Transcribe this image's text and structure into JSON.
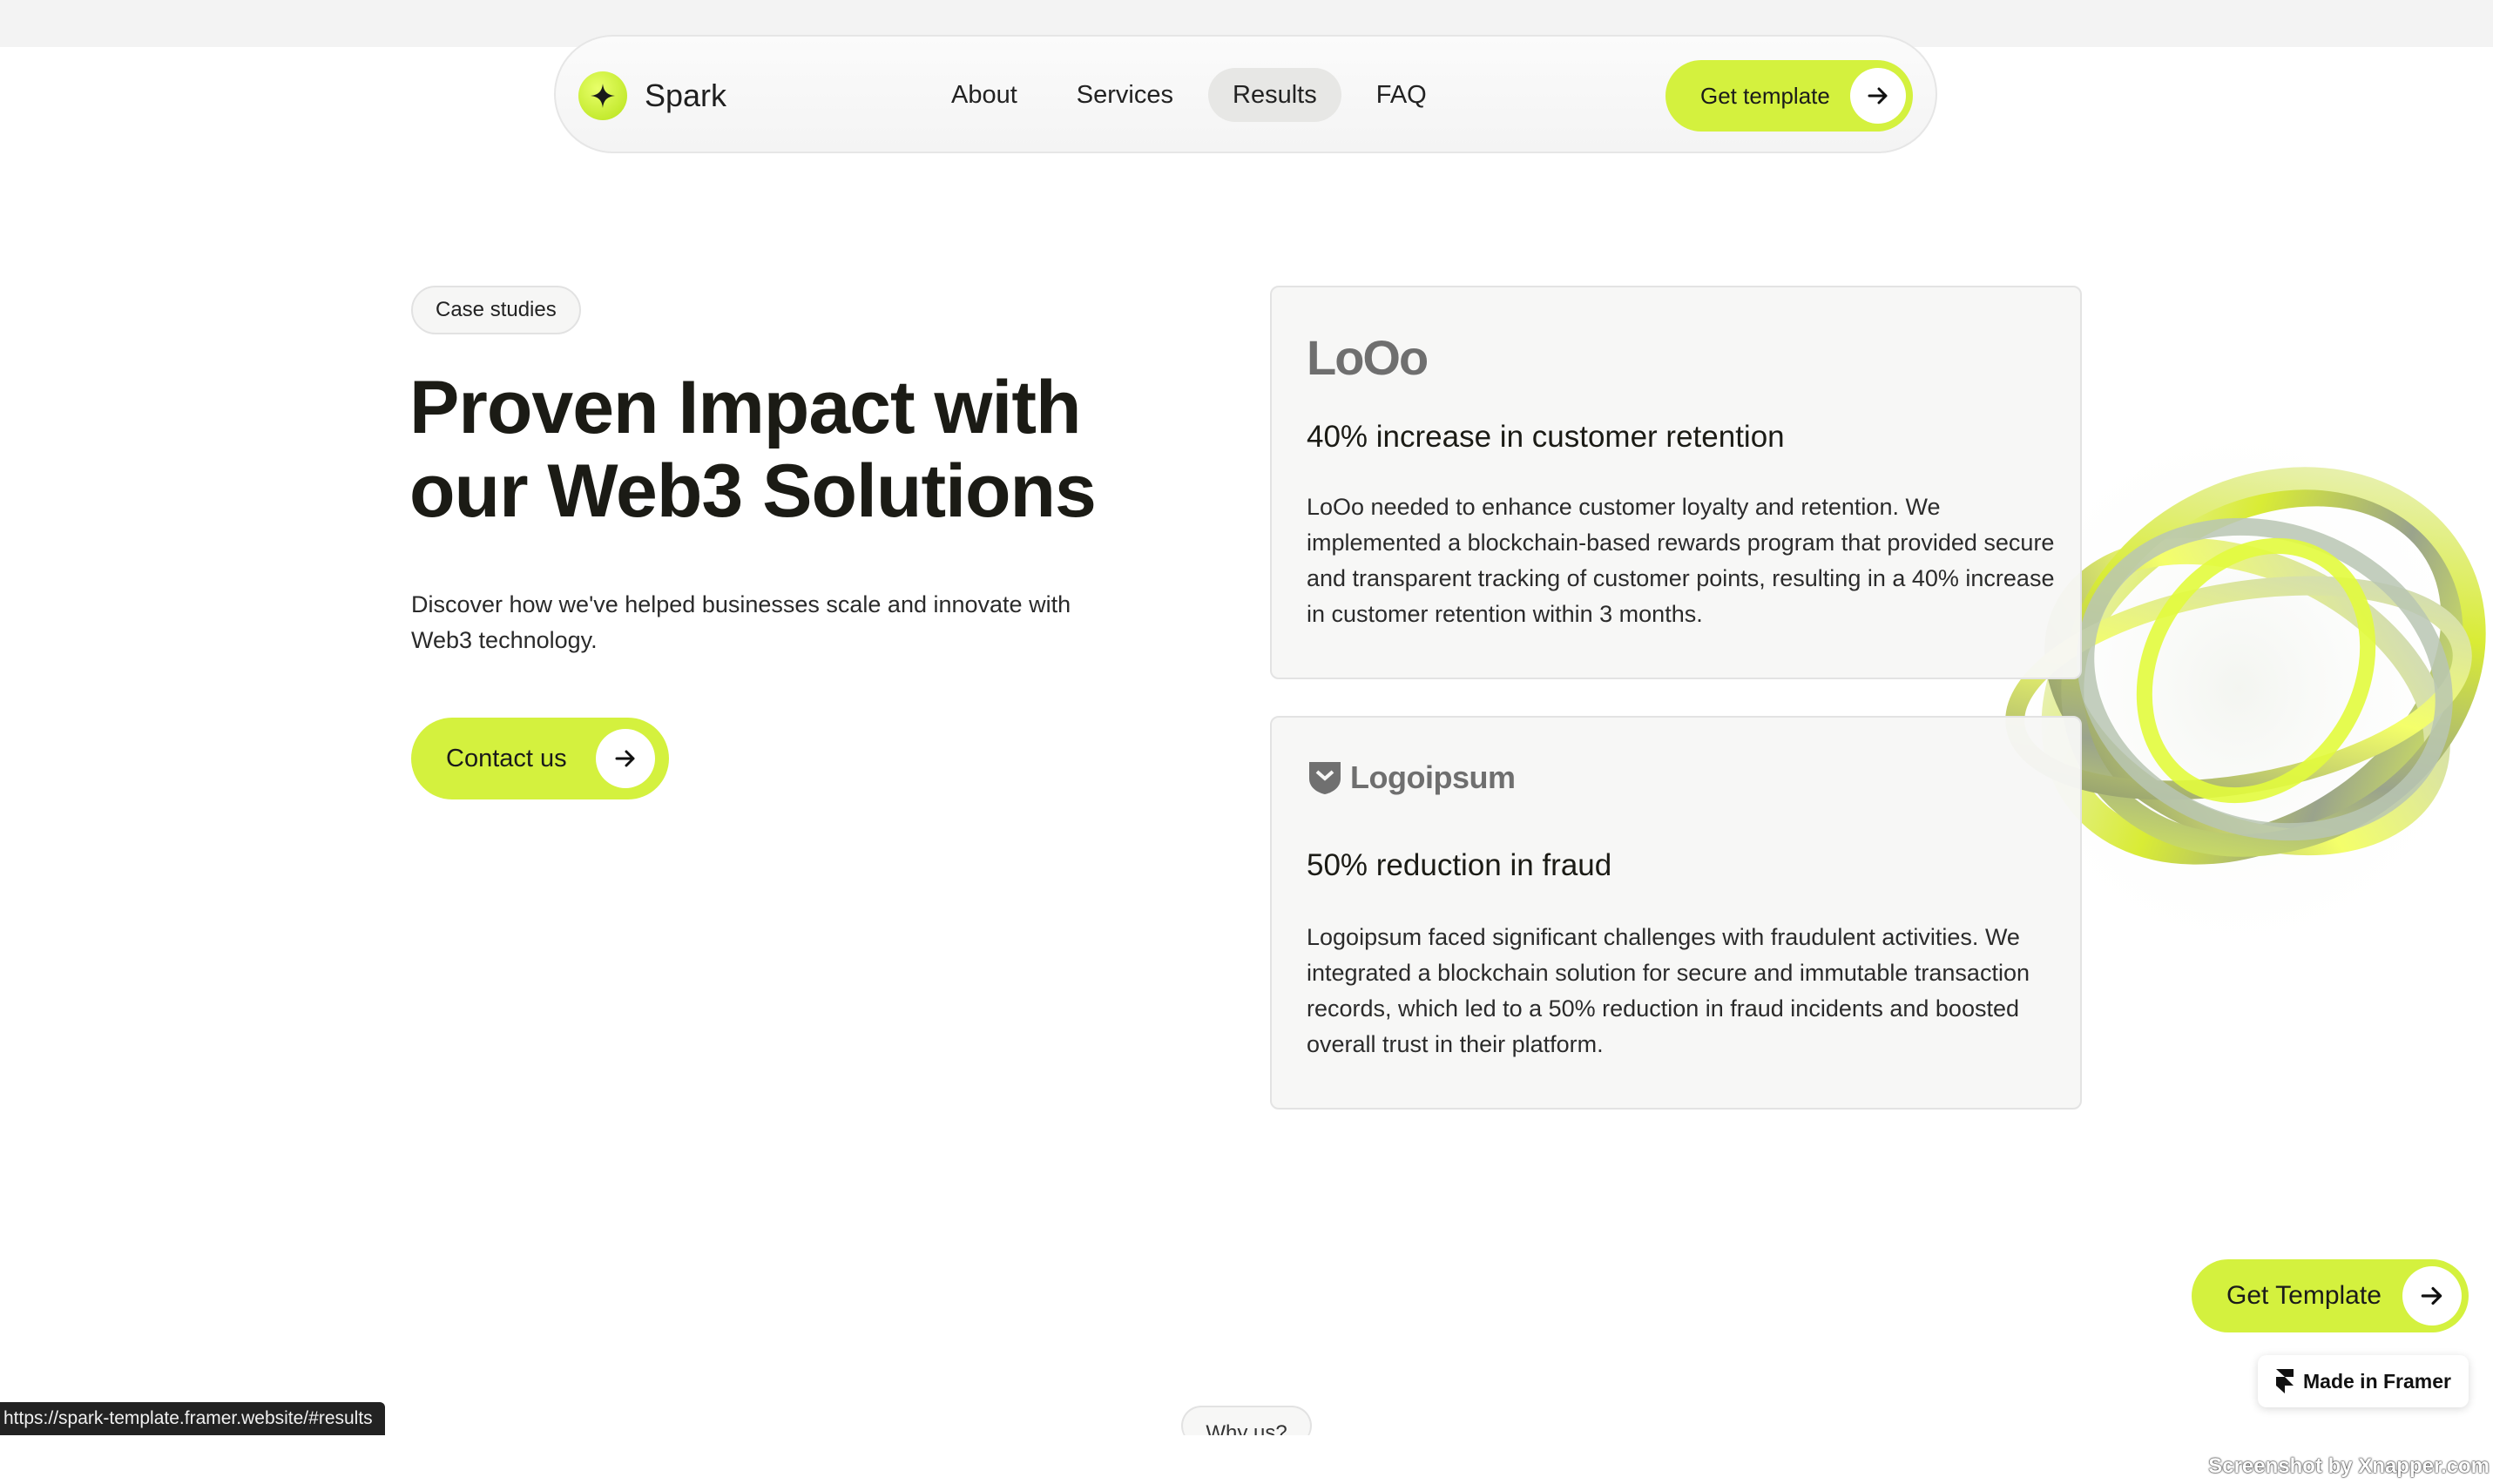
{
  "nav": {
    "brand": "Spark",
    "links": [
      {
        "label": "About"
      },
      {
        "label": "Services"
      },
      {
        "label": "Results"
      },
      {
        "label": "FAQ"
      }
    ],
    "active_link": "Results",
    "cta_label": "Get template"
  },
  "hero": {
    "tag": "Case studies",
    "title_line1": "Proven Impact with",
    "title_line2": "our Web3 Solutions",
    "description": "Discover how we've helped businesses scale and innovate with Web3 technology.",
    "contact_label": "Contact us"
  },
  "cases": [
    {
      "logo_text": "LoOo",
      "heading": "40% increase in customer retention",
      "body": "LoOo needed to enhance customer loyalty and retention. We implemented a blockchain-based rewards program that provided secure and transparent tracking of customer points, resulting in a 40% increase in customer retention within 3 months."
    },
    {
      "logo_text": "Logoipsum",
      "heading": "50% reduction in fraud",
      "body": "Logoipsum faced significant challenges with fraudulent activities. We integrated a blockchain solution for secure and immutable transaction records, which led to a 50% reduction in fraud incidents and boosted overall trust in their platform."
    }
  ],
  "floating": {
    "cta_label": "Get Template",
    "framer_label": "Made in Framer"
  },
  "next_section_tag": "Why us?",
  "status_bar_url": "https://spark-template.framer.website/#results",
  "watermark": "Screenshot by Xnapper.com",
  "colors": {
    "accent": "#d4f13e",
    "text": "#1b1b15",
    "card_bg": "#f7f7f6",
    "active_nav_bg": "#e7e7e5"
  },
  "icons": {
    "brand": "sparkle-icon",
    "cta": "arrow-right-icon",
    "framer": "framer-logo-icon",
    "logoipsum": "shield-logo-icon"
  }
}
